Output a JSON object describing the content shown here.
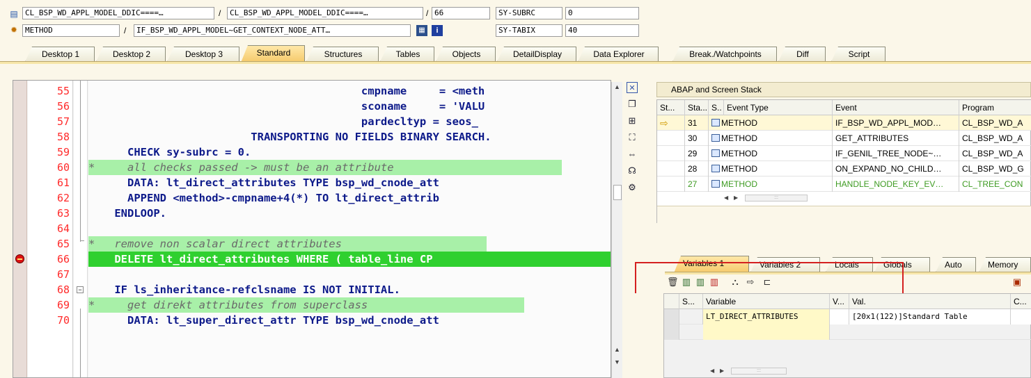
{
  "header": {
    "row1": {
      "field1": "CL_BSP_WD_APPL_MODEL_DDIC====…",
      "sep1": "/",
      "field2": "CL_BSP_WD_APPL_MODEL_DDIC====…",
      "sep2": "/",
      "field3": "66",
      "label": "SY-SUBRC",
      "value": "0"
    },
    "row2": {
      "field1": "METHOD",
      "sep1": "/",
      "field2": "IF_BSP_WD_APPL_MODEL~GET_CONTEXT_NODE_ATT…",
      "label": "SY-TABIX",
      "value": "40"
    }
  },
  "tabs": [
    "Desktop 1",
    "Desktop 2",
    "Desktop 3",
    "Standard",
    "Structures",
    "Tables",
    "Objects",
    "DetailDisplay",
    "Data Explorer",
    "Break./Watchpoints",
    "Diff",
    "Script"
  ],
  "active_tab": "Standard",
  "editor": {
    "lines": [
      {
        "num": "55",
        "text": "                                          cmpname     = <meth",
        "kind": "code"
      },
      {
        "num": "56",
        "text": "                                          sconame     = 'VALU",
        "kind": "code"
      },
      {
        "num": "57",
        "text": "                                          pardecltyp = seos_",
        "kind": "code"
      },
      {
        "num": "58",
        "text": "                         TRANSPORTING NO FIELDS BINARY SEARCH.",
        "kind": "code"
      },
      {
        "num": "59",
        "text": "      CHECK sy-subrc = 0.",
        "kind": "code"
      },
      {
        "num": "60",
        "text": "*     all checks passed -> must be an attribute",
        "kind": "comment"
      },
      {
        "num": "61",
        "text": "      DATA: lt_direct_attributes TYPE bsp_wd_cnode_att",
        "kind": "code"
      },
      {
        "num": "62",
        "text": "      APPEND <method>-cmpname+4(*) TO lt_direct_attrib",
        "kind": "code"
      },
      {
        "num": "63",
        "text": "    ENDLOOP.",
        "kind": "code"
      },
      {
        "num": "64",
        "text": "",
        "kind": "code"
      },
      {
        "num": "65",
        "text": "*   remove non scalar direct attributes",
        "kind": "comment"
      },
      {
        "num": "66",
        "text": "    DELETE lt_direct_attributes WHERE ( table_line CP",
        "kind": "current"
      },
      {
        "num": "67",
        "text": "",
        "kind": "code"
      },
      {
        "num": "68",
        "text": "    IF ls_inheritance-refclsname IS NOT INITIAL.",
        "kind": "code"
      },
      {
        "num": "69",
        "text": "*     get direkt attributes from superclass",
        "kind": "comment"
      },
      {
        "num": "70",
        "text": "      DATA: lt_super_direct_attr TYPE bsp_wd_cnode_att",
        "kind": "code"
      }
    ]
  },
  "toolbar_icons": [
    "close-icon",
    "new-window-icon",
    "structure-icon",
    "fullscreen-icon",
    "width-icon",
    "headset-icon",
    "settings-icon"
  ],
  "stack": {
    "title": "ABAP and Screen Stack",
    "headers": [
      "St...",
      "Sta...",
      "S..",
      "Event Type",
      "Event",
      "Program"
    ],
    "rows": [
      {
        "marker": "⇨",
        "level": "31",
        "type": "METHOD",
        "event": "IF_BSP_WD_APPL_MOD…",
        "program": "CL_BSP_WD_A"
      },
      {
        "marker": "",
        "level": "30",
        "type": "METHOD",
        "event": "GET_ATTRIBUTES",
        "program": "CL_BSP_WD_A"
      },
      {
        "marker": "",
        "level": "29",
        "type": "METHOD",
        "event": "IF_GENIL_TREE_NODE~…",
        "program": "CL_BSP_WD_A"
      },
      {
        "marker": "",
        "level": "28",
        "type": "METHOD",
        "event": "ON_EXPAND_NO_CHILD…",
        "program": "CL_BSP_WD_G"
      },
      {
        "marker": "",
        "level": "27",
        "type": "METHOD",
        "event": "HANDLE_NODE_KEY_EV…",
        "program": "CL_TREE_CON"
      }
    ]
  },
  "var_tabs": [
    "Variables 1",
    "Variables 2",
    "Locals",
    "Globals",
    "Auto",
    "Memory"
  ],
  "var_active_tab": "Variables 1",
  "variables": {
    "headers": [
      "S...",
      "Variable",
      "V...",
      "Val.",
      "C..."
    ],
    "rows": [
      {
        "variable": "LT_DIRECT_ATTRIBUTES",
        "value": "[20x1(122)]Standard Table"
      }
    ]
  },
  "colors": {
    "background": "#fbf7e9",
    "line_number": "#ff2a2a",
    "keyword": "#0d1a8a",
    "comment_bg": "#a8f0a8",
    "current_line_bg": "#2fd02f",
    "tab_active": "#f5c96a"
  }
}
